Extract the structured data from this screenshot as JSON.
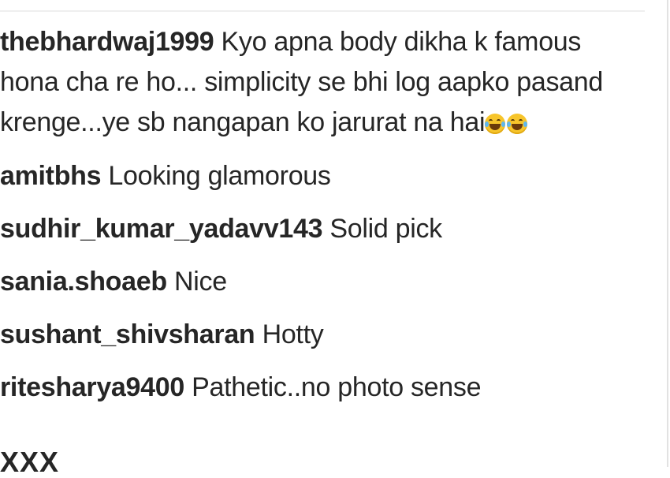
{
  "comments": [
    {
      "username": "thebhardwaj1999",
      "text": "Kyo apna body dikha k famous hona cha re ho... simplicity se bhi log aapko pasand krenge...ye sb nangapan ko jarurat na hai",
      "emojis": [
        "face-with-tears-of-joy-icon",
        "face-with-tears-of-joy-icon"
      ]
    },
    {
      "username": "amitbhs",
      "text": "Looking glamorous"
    },
    {
      "username": "sudhir_kumar_yadavv143",
      "text": "Solid pick"
    },
    {
      "username": "sania.shoaeb",
      "text": "Nice"
    },
    {
      "username": "sushant_shivsharan",
      "text": "Hotty"
    },
    {
      "username": "ritesharya9400",
      "text": "Pathetic..no photo sense"
    }
  ],
  "partial_next_line": "XXX",
  "colors": {
    "text": "#262626",
    "divider": "#efefef",
    "background": "#ffffff"
  }
}
